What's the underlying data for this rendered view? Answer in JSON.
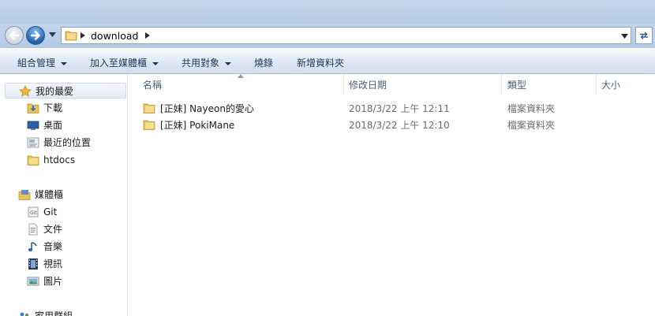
{
  "address": {
    "crumbs": [
      "download"
    ]
  },
  "toolbar": {
    "items": [
      {
        "label": "組合管理",
        "has_menu": true
      },
      {
        "label": "加入至媒體櫃",
        "has_menu": true
      },
      {
        "label": "共用對象",
        "has_menu": true
      },
      {
        "label": "燒錄",
        "has_menu": false
      },
      {
        "label": "新增資料夾",
        "has_menu": false
      }
    ]
  },
  "nav": {
    "favorites": {
      "label": "我的最愛",
      "items": [
        {
          "label": "下載",
          "icon": "downloads-folder-icon"
        },
        {
          "label": "桌面",
          "icon": "desktop-icon"
        },
        {
          "label": "最近的位置",
          "icon": "recent-places-icon"
        },
        {
          "label": "htdocs",
          "icon": "folder-icon"
        }
      ]
    },
    "libraries": {
      "label": "媒體櫃",
      "items": [
        {
          "label": "Git",
          "icon": "git-library-icon"
        },
        {
          "label": "文件",
          "icon": "documents-icon"
        },
        {
          "label": "音樂",
          "icon": "music-icon"
        },
        {
          "label": "視訊",
          "icon": "videos-icon"
        },
        {
          "label": "圖片",
          "icon": "pictures-icon"
        }
      ]
    },
    "homegroup": {
      "label": "家用群組"
    }
  },
  "columns": {
    "name": "名稱",
    "date": "修改日期",
    "type": "類型",
    "size": "大小"
  },
  "files": [
    {
      "name": "[正妹] Nayeon的愛心",
      "date": "2018/3/22 上午 12:11",
      "type": "檔案資料夾"
    },
    {
      "name": "[正妹] PokiMane",
      "date": "2018/3/22 上午 12:10",
      "type": "檔案資料夾"
    }
  ],
  "colors": {
    "accent": "#1e395b",
    "folder": "#e9c15a",
    "header_text": "#4c607a"
  }
}
